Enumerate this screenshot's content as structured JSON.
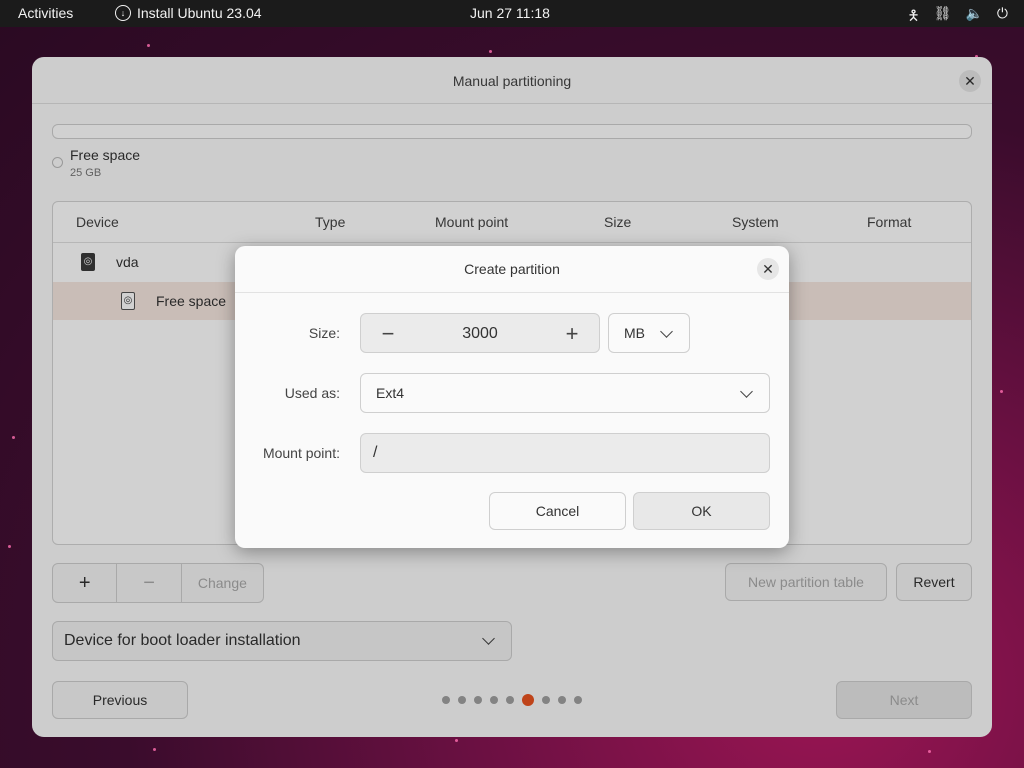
{
  "topbar": {
    "activities": "Activities",
    "app_title": "Install Ubuntu 23.04",
    "clock": "Jun 27  11:18",
    "tray_icons": [
      "accessibility-icon",
      "network-icon",
      "volume-icon",
      "power-icon"
    ]
  },
  "window": {
    "title": "Manual partitioning",
    "legend": {
      "name": "Free space",
      "size": "25 GB"
    },
    "table": {
      "columns": [
        "Device",
        "Type",
        "Mount point",
        "Size",
        "System",
        "Format"
      ],
      "rows": [
        {
          "device": "vda"
        },
        {
          "device": "Free space"
        }
      ]
    },
    "buttons": {
      "add": "+",
      "remove": "−",
      "change": "Change",
      "new_table": "New partition table",
      "revert": "Revert",
      "previous": "Previous",
      "next": "Next"
    },
    "bootloader_label": "Device for boot loader installation",
    "pagination": {
      "total": 9,
      "current": 6
    }
  },
  "dialog": {
    "title": "Create partition",
    "size_label": "Size:",
    "size_value": "3000",
    "unit": "MB",
    "used_as_label": "Used as:",
    "used_as_value": "Ext4",
    "mount_label": "Mount point:",
    "mount_value": "/",
    "cancel": "Cancel",
    "ok": "OK"
  },
  "colors": {
    "accent": "#e95420",
    "selected_row": "#f6e7e0",
    "topbar": "#1b1b1b"
  }
}
